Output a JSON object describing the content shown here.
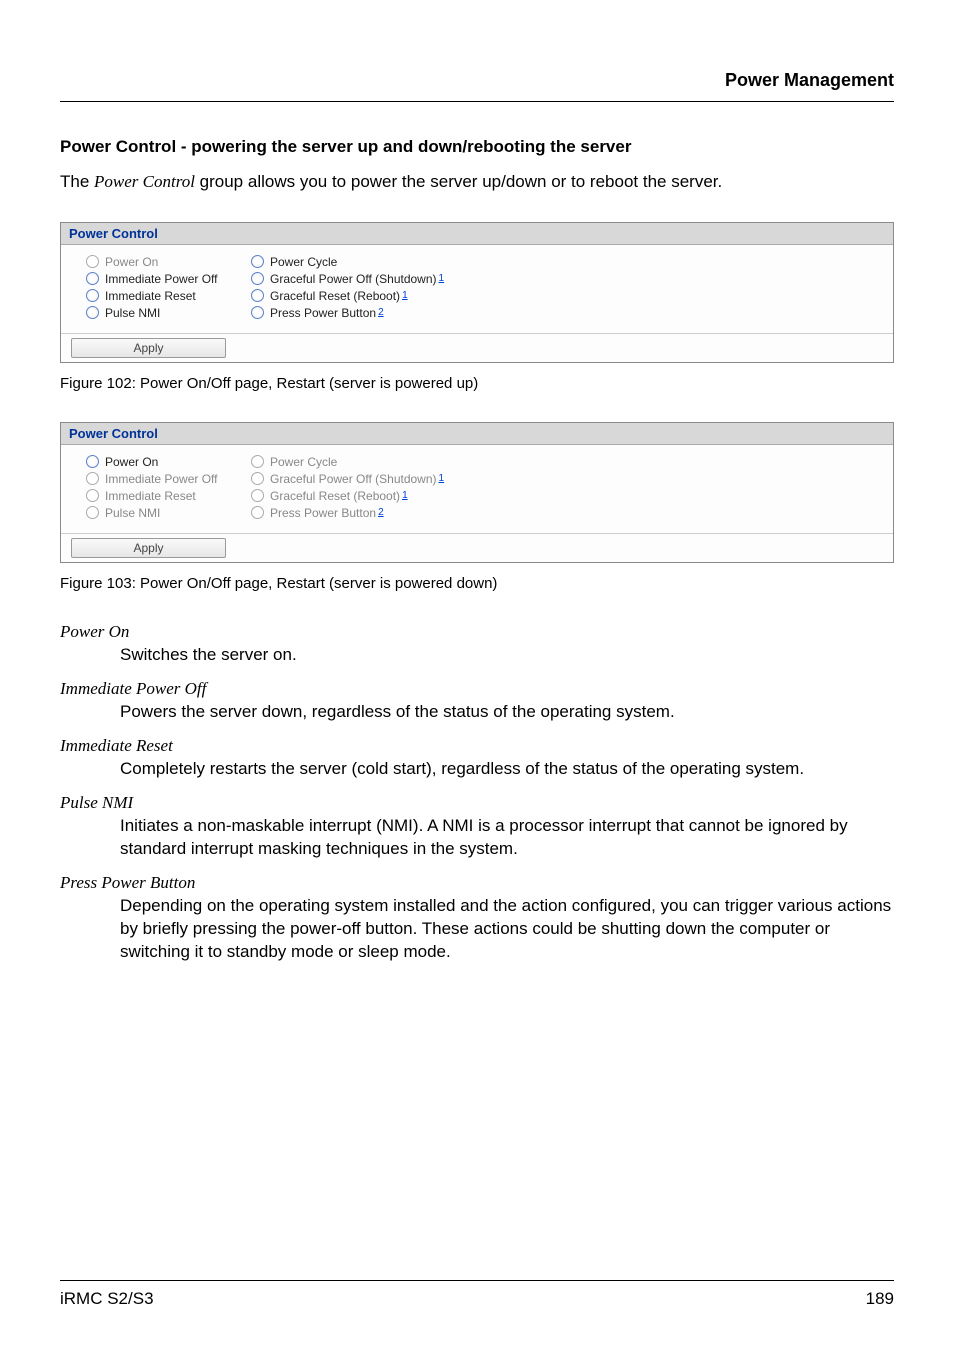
{
  "header": {
    "title": "Power Management"
  },
  "section": {
    "heading": "Power Control - powering the server up and down/rebooting the server",
    "intro_pre": "The ",
    "intro_italic": "Power Control",
    "intro_post": " group allows you to power the server up/down or to reboot the server."
  },
  "panel1": {
    "title": "Power Control",
    "options": {
      "power_on": "Power On",
      "imm_power_off": "Immediate Power Off",
      "imm_reset": "Immediate Reset",
      "pulse_nmi": "Pulse NMI",
      "power_cycle": "Power Cycle",
      "graceful_off": "Graceful Power Off (Shutdown)",
      "graceful_reset": "Graceful Reset (Reboot)",
      "press_power": "Press Power Button",
      "sup1": "1",
      "sup2": "2"
    },
    "apply": "Apply"
  },
  "figure1_caption": "Figure 102: Power On/Off page, Restart (server is powered up)",
  "panel2": {
    "title": "Power Control",
    "options": {
      "power_on": "Power On",
      "imm_power_off": "Immediate Power Off",
      "imm_reset": "Immediate Reset",
      "pulse_nmi": "Pulse NMI",
      "power_cycle": "Power Cycle",
      "graceful_off": "Graceful Power Off (Shutdown)",
      "graceful_reset": "Graceful Reset (Reboot)",
      "press_power": "Press Power Button",
      "sup1": "1",
      "sup2": "2"
    },
    "apply": "Apply"
  },
  "figure2_caption": "Figure 103: Power On/Off page, Restart (server is powered down)",
  "defs": {
    "power_on": {
      "term": "Power On",
      "body": "Switches the server on."
    },
    "imm_power_off": {
      "term": "Immediate Power Off",
      "body": "Powers the server down, regardless of the status of the operating system."
    },
    "imm_reset": {
      "term": "Immediate Reset",
      "body": "Completely restarts the server (cold start), regardless of the status of the operating system."
    },
    "pulse_nmi": {
      "term": "Pulse NMI",
      "body": "Initiates a non-maskable interrupt (NMI). A NMI is a processor interrupt that cannot be ignored by standard interrupt masking techniques in the system."
    },
    "press_power": {
      "term": "Press Power Button",
      "body": "Depending on the operating system installed and the action configured, you can trigger various actions by briefly pressing the power-off button. These actions could be shutting down the computer or switching it to standby mode or sleep mode."
    }
  },
  "footer": {
    "left": "iRMC S2/S3",
    "right": "189"
  }
}
